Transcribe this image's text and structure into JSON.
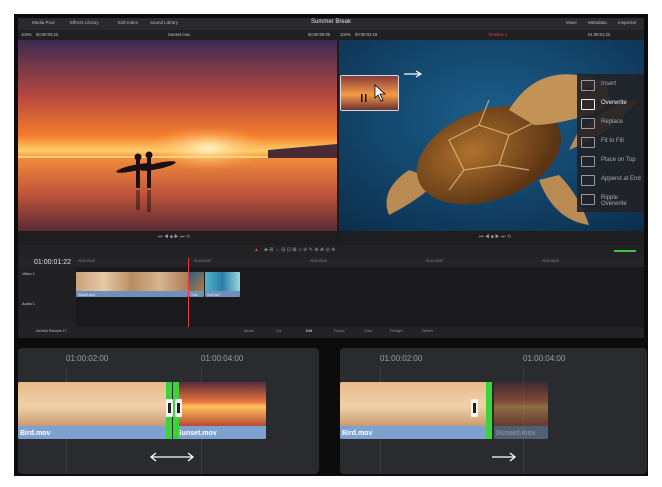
{
  "app": {
    "top_tabs": [
      "Media Pool",
      "Effects Library",
      "Edit Index",
      "Sound Library"
    ],
    "title": "Summer Break",
    "right_tabs": [
      "Mixer",
      "Metadata",
      "Inspector"
    ],
    "sub_left": [
      "104%",
      "00:00:03:22"
    ],
    "sub_center": "Sunset.mov",
    "sub_right": [
      "00:00:00:00",
      "104%",
      "00:00:02:19"
    ],
    "sub_timeline": "Timeline 1",
    "sub_tc_right": "01:00:01:22"
  },
  "edit_menu": {
    "items": [
      {
        "label": "Insert",
        "icon": "insert-icon",
        "selected": false
      },
      {
        "label": "Overwrite",
        "icon": "overwrite-icon",
        "selected": true
      },
      {
        "label": "Replace",
        "icon": "replace-icon",
        "selected": false
      },
      {
        "label": "Fit to Fill",
        "icon": "fit-to-fill-icon",
        "selected": false
      },
      {
        "label": "Place on Top",
        "icon": "place-on-top-icon",
        "selected": false
      },
      {
        "label": "Append at End",
        "icon": "append-at-end-icon",
        "selected": false
      },
      {
        "label": "Ripple Overwrite",
        "icon": "ripple-overwrite-icon",
        "selected": false
      }
    ]
  },
  "timeline": {
    "timecode": "01:00:01:22",
    "ruler_labels": [
      "01:00:00:00",
      "01:00:01:00",
      "01:00:02:00",
      "01:00:03:00",
      "01:00:04:00"
    ],
    "tracks": [
      {
        "name": "Video 1",
        "id": "V1"
      },
      {
        "name": "Audio 1",
        "id": "A1",
        "level": "2.0"
      }
    ],
    "clips": [
      {
        "label": "Sunset.mp4"
      },
      {
        "label": "Turtl..."
      },
      {
        "label": "Surf.mov"
      }
    ]
  },
  "pages": {
    "brand": "DaVinci Resolve 17",
    "items": [
      "Media",
      "Cut",
      "Edit",
      "Fusion",
      "Color",
      "Fairlight",
      "Deliver"
    ],
    "active": "Edit"
  },
  "trim_demos": [
    {
      "timecodes": [
        "01:00:02:00",
        "01:00:04:00"
      ],
      "clip_a": "Bird.mov",
      "clip_b": "Sunset.mov",
      "arrow": "double"
    },
    {
      "timecodes": [
        "01:00:02:00",
        "01:00:04:00"
      ],
      "clip_a": "Bird.mov",
      "clip_b": "Sunset.mov",
      "arrow": "right"
    }
  ],
  "colors": {
    "accent_red": "#e53b36",
    "trim_green": "#3ad43a",
    "clip_blue": "#7ea1cf",
    "panel_bg": "#2a2b2f"
  }
}
